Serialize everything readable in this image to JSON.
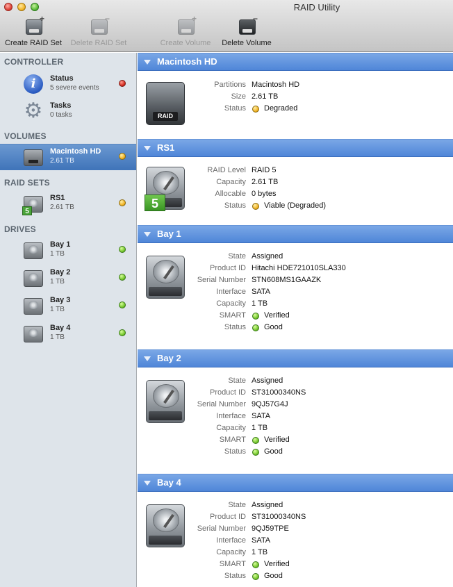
{
  "window": {
    "title": "RAID Utility"
  },
  "toolbar": {
    "create_raid_set": "Create RAID Set",
    "delete_raid_set": "Delete RAID Set",
    "create_volume": "Create Volume",
    "delete_volume": "Delete Volume",
    "raid_label": "RAID"
  },
  "sidebar": {
    "controller_header": "CONTROLLER",
    "status": {
      "title": "Status",
      "subtitle": "5 severe events",
      "indicator": "red"
    },
    "tasks": {
      "title": "Tasks",
      "subtitle": "0 tasks"
    },
    "volumes_header": "VOLUMES",
    "volume": {
      "title": "Macintosh HD",
      "subtitle": "2.61 TB",
      "indicator": "yellow"
    },
    "raid_sets_header": "RAID SETS",
    "raid_set": {
      "title": "RS1",
      "subtitle": "2.61 TB",
      "indicator": "yellow",
      "level_badge": "5"
    },
    "drives_header": "DRIVES",
    "drives": [
      {
        "title": "Bay 1",
        "subtitle": "1 TB",
        "indicator": "green"
      },
      {
        "title": "Bay 2",
        "subtitle": "1 TB",
        "indicator": "green"
      },
      {
        "title": "Bay 3",
        "subtitle": "1 TB",
        "indicator": "green"
      },
      {
        "title": "Bay 4",
        "subtitle": "1 TB",
        "indicator": "green"
      }
    ]
  },
  "main": {
    "volume": {
      "header": "Macintosh HD",
      "badge": "RAID",
      "labels": {
        "partitions": "Partitions",
        "size": "Size",
        "status": "Status"
      },
      "values": {
        "partitions": "Macintosh HD",
        "size": "2.61 TB",
        "status": "Degraded"
      }
    },
    "raid_set": {
      "header": "RS1",
      "level_badge": "5",
      "labels": {
        "raid_level": "RAID Level",
        "capacity": "Capacity",
        "allocable": "Allocable",
        "status": "Status"
      },
      "values": {
        "raid_level": "RAID 5",
        "capacity": "2.61 TB",
        "allocable": "0 bytes",
        "status": "Viable (Degraded)"
      }
    },
    "drive_labels": {
      "state": "State",
      "product_id": "Product ID",
      "serial_number": "Serial Number",
      "interface": "Interface",
      "capacity": "Capacity",
      "smart": "SMART",
      "status": "Status"
    },
    "drives": [
      {
        "header": "Bay 1",
        "state": "Assigned",
        "product_id": "Hitachi HDE721010SLA330",
        "serial_number": "STN608MS1GAAZK",
        "interface": "SATA",
        "capacity": "1 TB",
        "smart": "Verified",
        "status": "Good"
      },
      {
        "header": "Bay 2",
        "state": "Assigned",
        "product_id": "ST31000340NS",
        "serial_number": "9QJ57G4J",
        "interface": "SATA",
        "capacity": "1 TB",
        "smart": "Verified",
        "status": "Good"
      },
      {
        "header": "Bay 4",
        "state": "Assigned",
        "product_id": "ST31000340NS",
        "serial_number": "9QJ59TPE",
        "interface": "SATA",
        "capacity": "1 TB",
        "smart": "Verified",
        "status": "Good"
      }
    ]
  }
}
